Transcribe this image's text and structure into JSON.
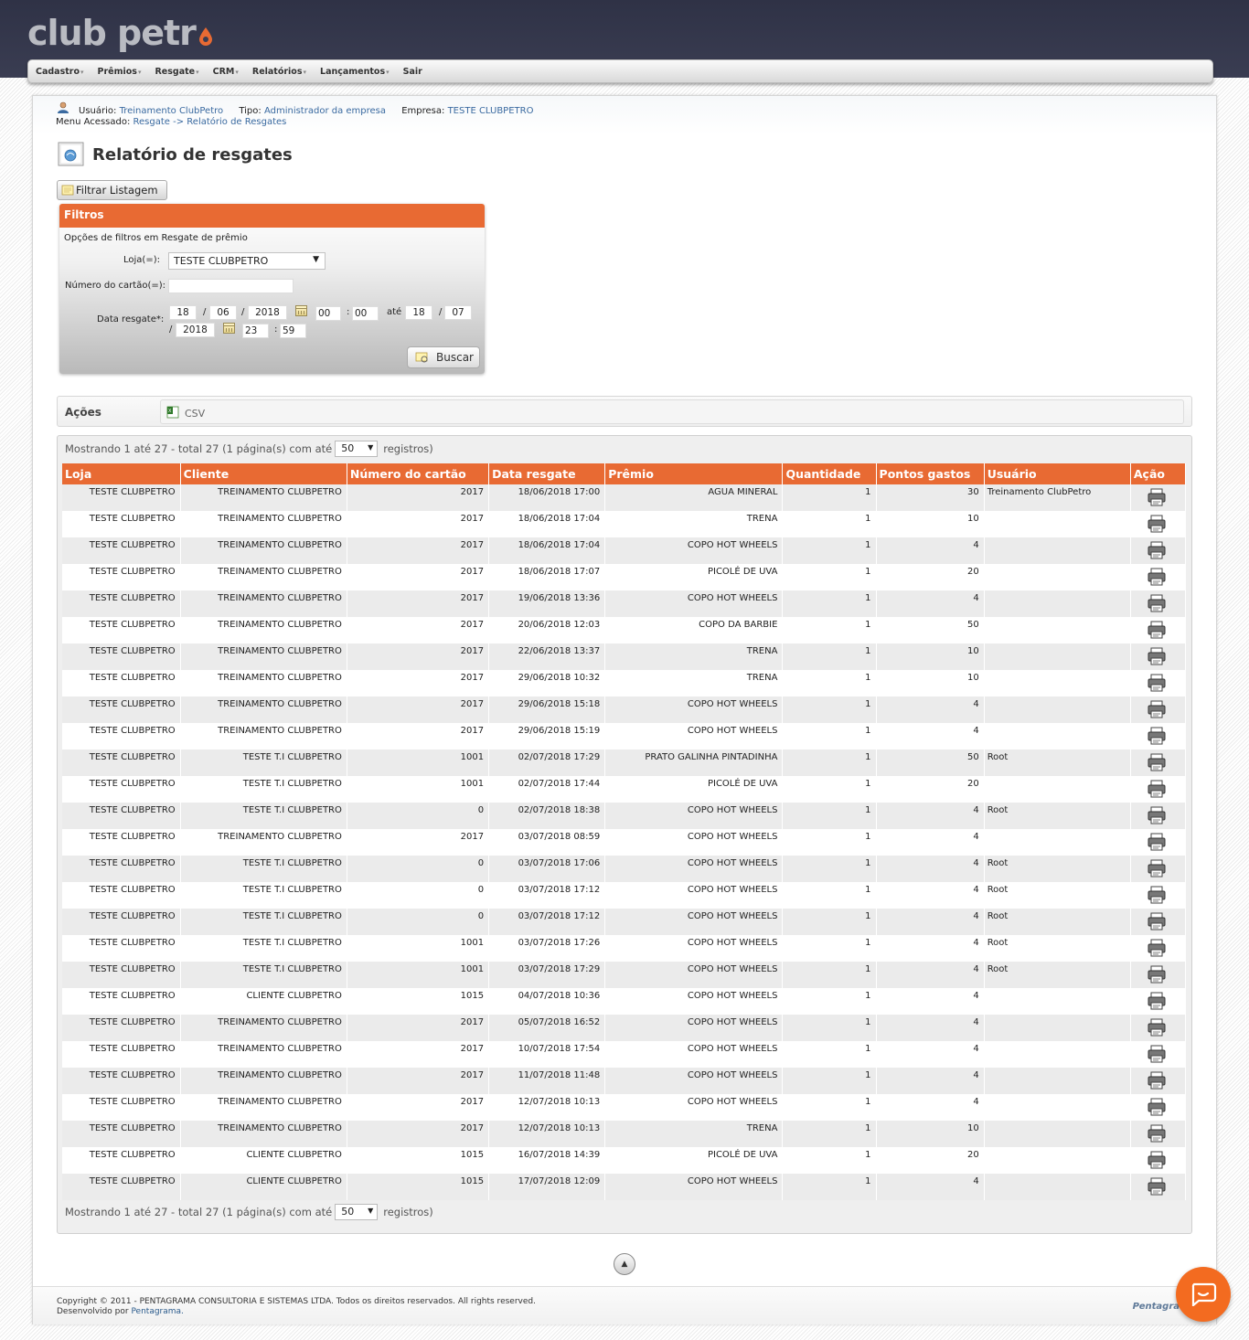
{
  "brand": {
    "logo_text": "club petr",
    "accent": "#e86a33"
  },
  "menu": [
    {
      "label": "Cadastro"
    },
    {
      "label": "Prêmios"
    },
    {
      "label": "Resgate"
    },
    {
      "label": "CRM"
    },
    {
      "label": "Relatórios"
    },
    {
      "label": "Lançamentos"
    },
    {
      "label": "Sair"
    }
  ],
  "user": {
    "usuario_label": "Usuário:",
    "usuario": "Treinamento ClubPetro",
    "tipo_label": "Tipo:",
    "tipo": "Administrador da empresa",
    "empresa_label": "Empresa:",
    "empresa": "TESTE CLUBPETRO",
    "menu_label": "Menu Acessado:",
    "menu_path": "Resgate -> Relatório de Resgates"
  },
  "page_title": "Relatório de resgates",
  "filter_button": "Filtrar Listagem",
  "filters": {
    "header": "Filtros",
    "subtitle": "Opções de filtros em Resgate de prêmio",
    "loja_label": "Loja(=):",
    "loja_value": "TESTE CLUBPETRO",
    "cartao_label": "Número do cartão(=):",
    "cartao_value": "",
    "data_label": "Data resgate*:",
    "from": {
      "day": "18",
      "month": "06",
      "year": "2018",
      "hour": "00",
      "min": "00"
    },
    "ate": "até",
    "to": {
      "day": "18",
      "month": "07",
      "year": "2018",
      "hour": "23",
      "min": "59"
    },
    "search_button": "Buscar"
  },
  "actions": {
    "label": "Ações",
    "csv": "CSV"
  },
  "pager": {
    "text": "Mostrando 1 até 27 - total 27 (1 página(s) com até",
    "per_page": "50",
    "suffix": "registros)"
  },
  "table": {
    "headers": [
      "Loja",
      "Cliente",
      "Número do cartão",
      "Data resgate",
      "Prêmio",
      "Quantidade",
      "Pontos gastos",
      "Usuário",
      "Ação"
    ],
    "rows": [
      [
        "TESTE CLUBPETRO",
        "TREINAMENTO CLUBPETRO",
        "2017",
        "18/06/2018 17:00",
        "AGUA MINERAL",
        "1",
        "30",
        "Treinamento ClubPetro"
      ],
      [
        "TESTE CLUBPETRO",
        "TREINAMENTO CLUBPETRO",
        "2017",
        "18/06/2018 17:04",
        "TRENA",
        "1",
        "10",
        ""
      ],
      [
        "TESTE CLUBPETRO",
        "TREINAMENTO CLUBPETRO",
        "2017",
        "18/06/2018 17:04",
        "COPO HOT WHEELS",
        "1",
        "4",
        ""
      ],
      [
        "TESTE CLUBPETRO",
        "TREINAMENTO CLUBPETRO",
        "2017",
        "18/06/2018 17:07",
        "PICOLÉ DE UVA",
        "1",
        "20",
        ""
      ],
      [
        "TESTE CLUBPETRO",
        "TREINAMENTO CLUBPETRO",
        "2017",
        "19/06/2018 13:36",
        "COPO HOT WHEELS",
        "1",
        "4",
        ""
      ],
      [
        "TESTE CLUBPETRO",
        "TREINAMENTO CLUBPETRO",
        "2017",
        "20/06/2018 12:03",
        "COPO DA BARBIE",
        "1",
        "50",
        ""
      ],
      [
        "TESTE CLUBPETRO",
        "TREINAMENTO CLUBPETRO",
        "2017",
        "22/06/2018 13:37",
        "TRENA",
        "1",
        "10",
        ""
      ],
      [
        "TESTE CLUBPETRO",
        "TREINAMENTO CLUBPETRO",
        "2017",
        "29/06/2018 10:32",
        "TRENA",
        "1",
        "10",
        ""
      ],
      [
        "TESTE CLUBPETRO",
        "TREINAMENTO CLUBPETRO",
        "2017",
        "29/06/2018 15:18",
        "COPO HOT WHEELS",
        "1",
        "4",
        ""
      ],
      [
        "TESTE CLUBPETRO",
        "TREINAMENTO CLUBPETRO",
        "2017",
        "29/06/2018 15:19",
        "COPO HOT WHEELS",
        "1",
        "4",
        ""
      ],
      [
        "TESTE CLUBPETRO",
        "TESTE T.I CLUBPETRO",
        "1001",
        "02/07/2018 17:29",
        "PRATO GALINHA PINTADINHA",
        "1",
        "50",
        "Root"
      ],
      [
        "TESTE CLUBPETRO",
        "TESTE T.I CLUBPETRO",
        "1001",
        "02/07/2018 17:44",
        "PICOLÉ DE UVA",
        "1",
        "20",
        ""
      ],
      [
        "TESTE CLUBPETRO",
        "TESTE T.I CLUBPETRO",
        "0",
        "02/07/2018 18:38",
        "COPO HOT WHEELS",
        "1",
        "4",
        "Root"
      ],
      [
        "TESTE CLUBPETRO",
        "TREINAMENTO CLUBPETRO",
        "2017",
        "03/07/2018 08:59",
        "COPO HOT WHEELS",
        "1",
        "4",
        ""
      ],
      [
        "TESTE CLUBPETRO",
        "TESTE T.I CLUBPETRO",
        "0",
        "03/07/2018 17:06",
        "COPO HOT WHEELS",
        "1",
        "4",
        "Root"
      ],
      [
        "TESTE CLUBPETRO",
        "TESTE T.I CLUBPETRO",
        "0",
        "03/07/2018 17:12",
        "COPO HOT WHEELS",
        "1",
        "4",
        "Root"
      ],
      [
        "TESTE CLUBPETRO",
        "TESTE T.I CLUBPETRO",
        "0",
        "03/07/2018 17:12",
        "COPO HOT WHEELS",
        "1",
        "4",
        "Root"
      ],
      [
        "TESTE CLUBPETRO",
        "TESTE T.I CLUBPETRO",
        "1001",
        "03/07/2018 17:26",
        "COPO HOT WHEELS",
        "1",
        "4",
        "Root"
      ],
      [
        "TESTE CLUBPETRO",
        "TESTE T.I CLUBPETRO",
        "1001",
        "03/07/2018 17:29",
        "COPO HOT WHEELS",
        "1",
        "4",
        "Root"
      ],
      [
        "TESTE CLUBPETRO",
        "CLIENTE CLUBPETRO",
        "1015",
        "04/07/2018 10:36",
        "COPO HOT WHEELS",
        "1",
        "4",
        ""
      ],
      [
        "TESTE CLUBPETRO",
        "TREINAMENTO CLUBPETRO",
        "2017",
        "05/07/2018 16:52",
        "COPO HOT WHEELS",
        "1",
        "4",
        ""
      ],
      [
        "TESTE CLUBPETRO",
        "TREINAMENTO CLUBPETRO",
        "2017",
        "10/07/2018 17:54",
        "COPO HOT WHEELS",
        "1",
        "4",
        ""
      ],
      [
        "TESTE CLUBPETRO",
        "TREINAMENTO CLUBPETRO",
        "2017",
        "11/07/2018 11:48",
        "COPO HOT WHEELS",
        "1",
        "4",
        ""
      ],
      [
        "TESTE CLUBPETRO",
        "TREINAMENTO CLUBPETRO",
        "2017",
        "12/07/2018 10:13",
        "COPO HOT WHEELS",
        "1",
        "4",
        ""
      ],
      [
        "TESTE CLUBPETRO",
        "TREINAMENTO CLUBPETRO",
        "2017",
        "12/07/2018 10:13",
        "TRENA",
        "1",
        "10",
        ""
      ],
      [
        "TESTE CLUBPETRO",
        "CLIENTE CLUBPETRO",
        "1015",
        "16/07/2018 14:39",
        "PICOLÉ DE UVA",
        "1",
        "20",
        ""
      ],
      [
        "TESTE CLUBPETRO",
        "CLIENTE CLUBPETRO",
        "1015",
        "17/07/2018 12:09",
        "COPO HOT WHEELS",
        "1",
        "4",
        ""
      ]
    ]
  },
  "footer": {
    "copyright": "Copyright © 2011 - PENTAGRAMA CONSULTORIA E SISTEMAS LTDA. Todos os direitos reservados. All rights reserved.",
    "dev_label": "Desenvolvido por",
    "dev_link": "Pentagrama.",
    "logo": "Pentagra"
  },
  "icons": {
    "user": "user-icon",
    "page": "report-icon",
    "filter": "filter-icon",
    "calendar": "calendar-icon",
    "csv": "csv-file-icon",
    "print": "printer-icon",
    "scroll_top": "arrow-up-icon",
    "chat": "chat-icon"
  }
}
